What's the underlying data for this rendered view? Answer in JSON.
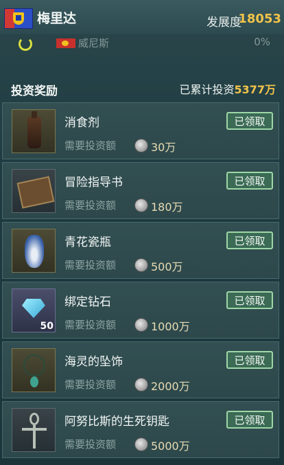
{
  "header": {
    "city_name": "梅里达",
    "development_label": "发展度",
    "development_value": "18053"
  },
  "top_strip": {
    "name": "威尼斯",
    "percent": "0%"
  },
  "section": {
    "title": "投资奖励",
    "total_label": "已累计投资",
    "total_value": "5377万"
  },
  "rewards": [
    {
      "name": "消食剂",
      "requirement_label": "需要投资额",
      "amount": "30万",
      "button": "已领取",
      "icon": "bottle-icon"
    },
    {
      "name": "冒险指导书",
      "requirement_label": "需要投资额",
      "amount": "180万",
      "button": "已领取",
      "icon": "book-icon"
    },
    {
      "name": "青花瓷瓶",
      "requirement_label": "需要投资额",
      "amount": "500万",
      "button": "已领取",
      "icon": "vase-icon"
    },
    {
      "name": "绑定钻石",
      "requirement_label": "需要投资额",
      "amount": "1000万",
      "button": "已领取",
      "icon": "diamond-icon",
      "count": "50"
    },
    {
      "name": "海灵的坠饰",
      "requirement_label": "需要投资额",
      "amount": "2000万",
      "button": "已领取",
      "icon": "pendant-icon"
    },
    {
      "name": "阿努比斯的生死钥匙",
      "requirement_label": "需要投资额",
      "amount": "5000万",
      "button": "已领取",
      "icon": "ankh-icon"
    }
  ]
}
